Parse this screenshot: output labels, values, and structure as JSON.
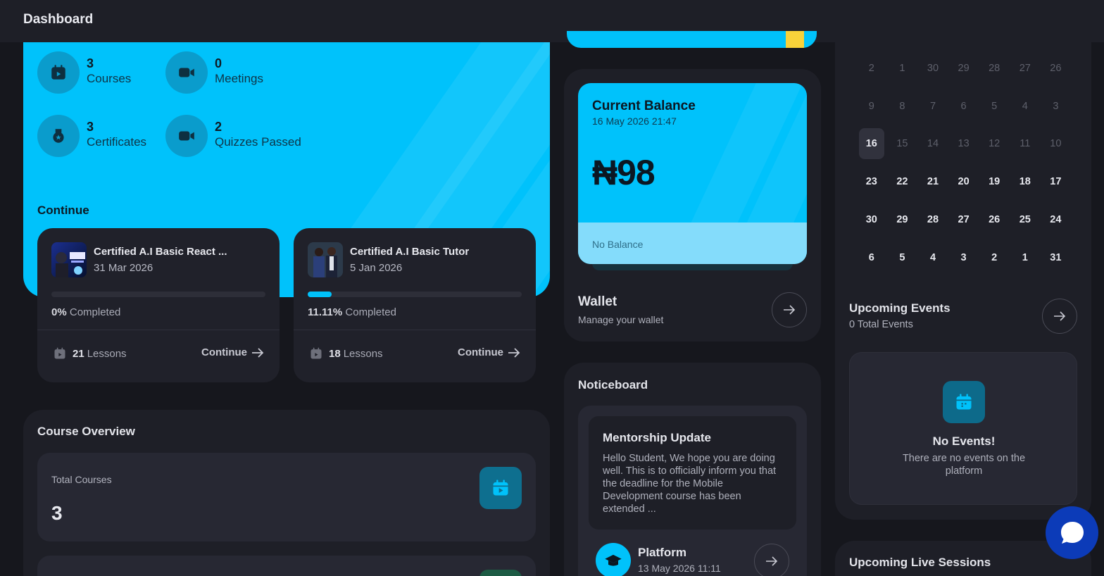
{
  "header": {
    "title": "Dashboard"
  },
  "stats": [
    {
      "value": "3",
      "label": "Courses",
      "icon": "play-calendar-icon"
    },
    {
      "value": "0",
      "label": "Meetings",
      "icon": "video-camera-icon"
    },
    {
      "value": "3",
      "label": "Certificates",
      "icon": "badge-icon"
    },
    {
      "value": "2",
      "label": "Quizzes Passed",
      "icon": "video-camera-icon"
    }
  ],
  "continue": {
    "label": "Continue",
    "courses": [
      {
        "title": "Certified A.I Basic React ...",
        "date": "31 Mar 2026",
        "progress_pct": 0,
        "pct_text": "0%",
        "completed_label": "Completed",
        "lessons_count": "21",
        "lessons_label": "Lessons",
        "button": "Continue"
      },
      {
        "title": "Certified A.I Basic Tutor",
        "date": "5 Jan 2026",
        "progress_pct": 11.11,
        "pct_text": "11.11%",
        "completed_label": "Completed",
        "lessons_count": "18",
        "lessons_label": "Lessons",
        "button": "Continue"
      }
    ]
  },
  "overview": {
    "title": "Course Overview",
    "total_label": "Total Courses",
    "total_value": "3"
  },
  "balance": {
    "title": "Current Balance",
    "date": "16 May 2026 21:47",
    "amount": "₦98",
    "footer": "No Balance"
  },
  "wallet": {
    "title": "Wallet",
    "subtitle": "Manage your wallet"
  },
  "noticeboard": {
    "title": "Noticeboard",
    "item": {
      "heading": "Mentorship Update",
      "body": "Hello Student, We hope you are doing well. This is to officially inform you that the deadline for the Mobile Development course has been extended ...",
      "author": "Platform",
      "timestamp": "13 May 2026 11:11"
    }
  },
  "calendar": {
    "today": "16",
    "weeks": [
      [
        "2",
        "1",
        "30",
        "29",
        "28",
        "27",
        "26"
      ],
      [
        "9",
        "8",
        "7",
        "6",
        "5",
        "4",
        "3"
      ],
      [
        "16",
        "15",
        "14",
        "13",
        "12",
        "11",
        "10"
      ],
      [
        "23",
        "22",
        "21",
        "20",
        "19",
        "18",
        "17"
      ],
      [
        "30",
        "29",
        "28",
        "27",
        "26",
        "25",
        "24"
      ],
      [
        "6",
        "5",
        "4",
        "3",
        "2",
        "1",
        "31"
      ]
    ]
  },
  "events": {
    "title": "Upcoming Events",
    "count_text": "0 Total Events",
    "empty_title": "No Events!",
    "empty_body": "There are no events on the platform"
  },
  "live_sessions": {
    "title": "Upcoming Live Sessions"
  },
  "colors": {
    "accent": "#00c2fb",
    "background": "#16171d",
    "panel": "#1e1f27",
    "chat": "#0c3bb8"
  }
}
